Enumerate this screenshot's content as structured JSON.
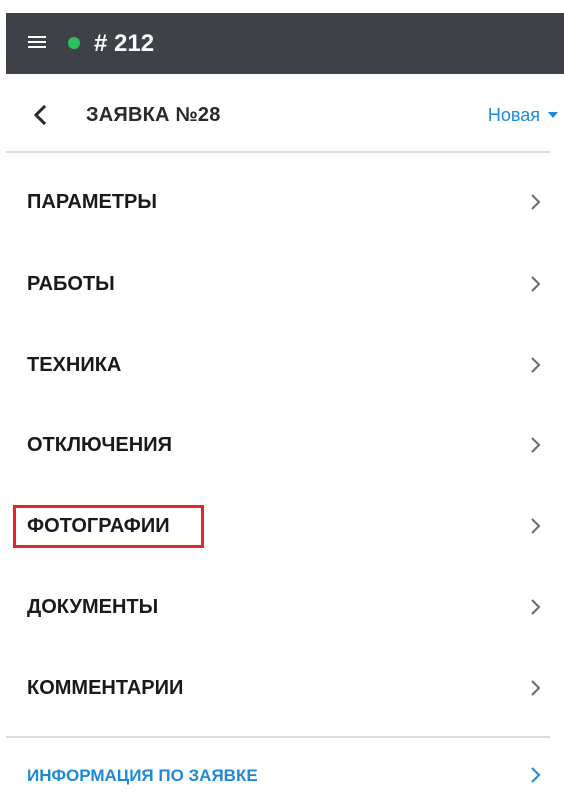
{
  "topbar": {
    "title": "# 212",
    "status_color": "#2ec05a"
  },
  "header": {
    "title": "ЗАЯВКА №28",
    "status_label": "Новая"
  },
  "sections": [
    {
      "label": "ПАРАМЕТРЫ"
    },
    {
      "label": "РАБОТЫ"
    },
    {
      "label": "ТЕХНИКА"
    },
    {
      "label": "ОТКЛЮЧЕНИЯ"
    },
    {
      "label": "ФОТОГРАФИИ",
      "highlighted": true
    },
    {
      "label": "ДОКУМЕНТЫ"
    },
    {
      "label": "КОММЕНТАРИИ"
    }
  ],
  "info_link": {
    "label": "ИНФОРМАЦИЯ ПО ЗАЯВКЕ"
  },
  "colors": {
    "accent": "#1e8ad6",
    "topbar": "#3e4248",
    "highlight": "#e0252b"
  }
}
